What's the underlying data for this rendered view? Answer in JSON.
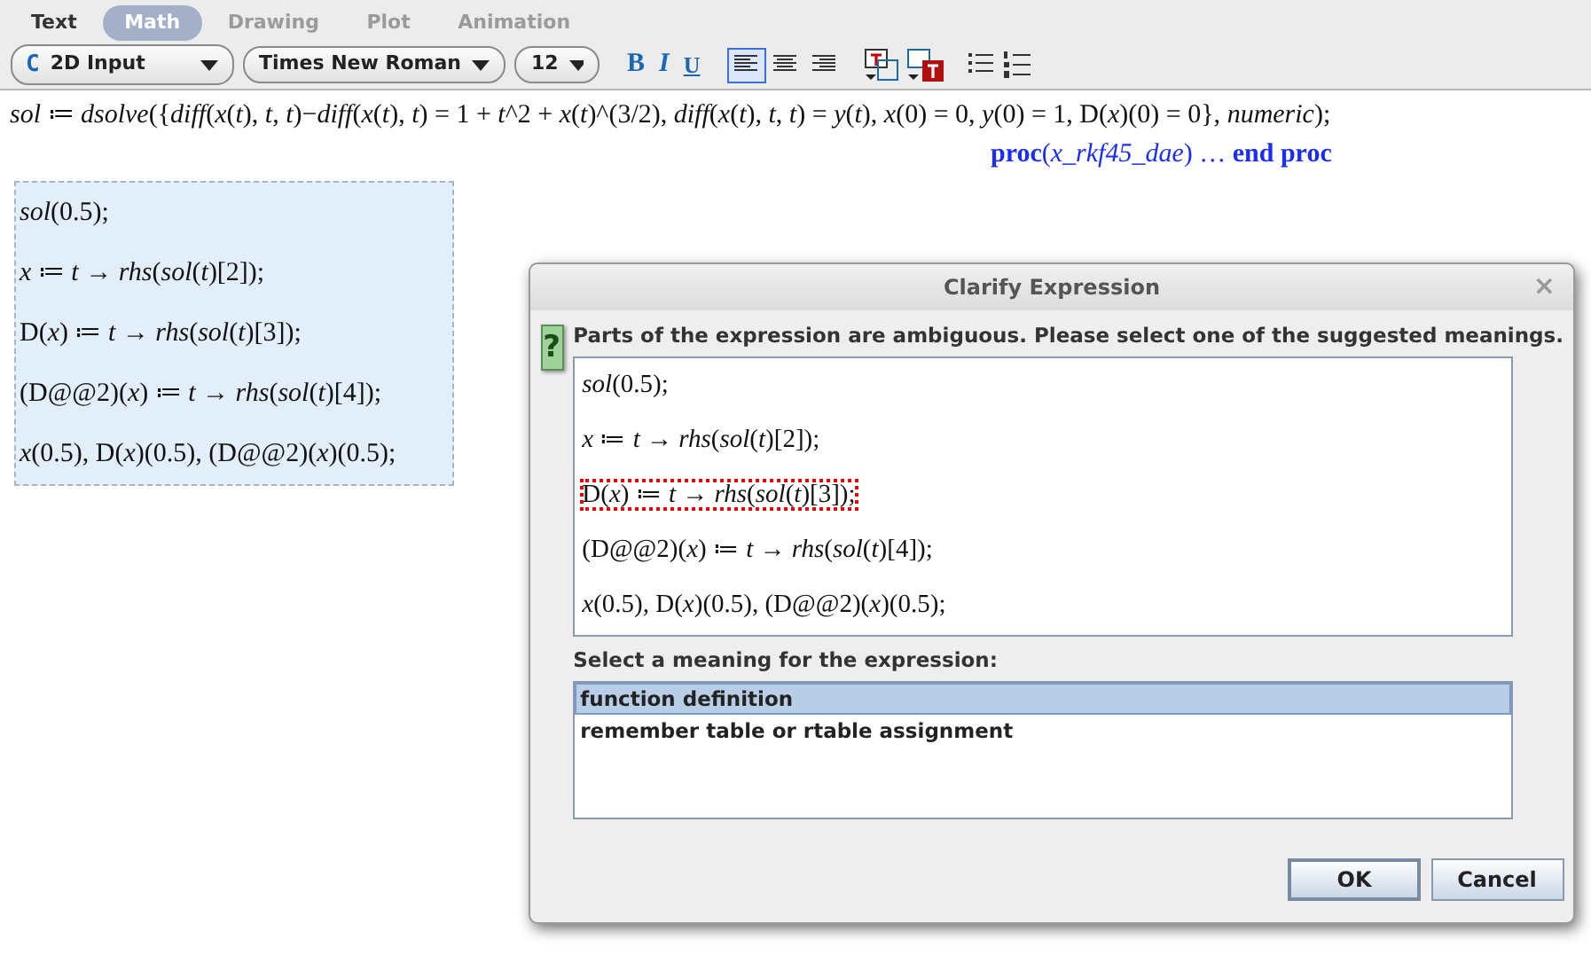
{
  "mode_tabs": [
    {
      "label": "Text",
      "selected": false
    },
    {
      "label": "Math",
      "selected": true
    },
    {
      "label": "Drawing",
      "selected": false
    },
    {
      "label": "Plot",
      "selected": false
    },
    {
      "label": "Animation",
      "selected": false
    }
  ],
  "toolbar": {
    "input_mode": {
      "icon": "C",
      "label": "2D Input"
    },
    "font": "Times New Roman",
    "size": "12",
    "styles": [
      {
        "label": "B",
        "kind": "bold",
        "on": false
      },
      {
        "label": "I",
        "kind": "italic",
        "on": false
      },
      {
        "label": "U",
        "kind": "underline",
        "on": false
      }
    ],
    "alignment": [
      {
        "kind": "left",
        "selected": true
      },
      {
        "kind": "center",
        "selected": false
      },
      {
        "kind": "right",
        "selected": false
      }
    ]
  },
  "document": {
    "input": "*sol* ≔ *dsolve*({*diff*(*x*(*t*), *t*, *t*)−*diff*(*x*(*t*), *t*) = 1 + *t*^2 + *x*(*t*)^(3/2), *diff*(*x*(*t*), *t*, *t*) = *y*(*t*), *x*(0) = 0, *y*(0) = 1, D(*x*)(0) = 0}, *numeric*);",
    "output": "**proc**(*x_rkf45_dae*)  …  **end proc**",
    "selected_block": [
      "*sol*(0.5);",
      "*x* ≔ *t* → *rhs*(*sol*(*t*)[2]);",
      "D(*x*) ≔ *t* → *rhs*(*sol*(*t*)[3]);",
      "(D@@2)(*x*) ≔ *t* → *rhs*(*sol*(*t*)[4]);",
      "*x*(0.5),  D(*x*)(0.5),  (D@@2)(*x*)(0.5);"
    ]
  },
  "dialog": {
    "title": "Clarify Expression",
    "close": "×",
    "icon": "?",
    "message": "Parts of the expression are ambiguous. Please select one of the suggested meanings.",
    "expressions": [
      {
        "text": "*sol*(0.5);",
        "selected": false
      },
      {
        "text": "*x* ≔ *t* → *rhs*(*sol*(*t*)[2]);",
        "selected": false
      },
      {
        "text": "D(*x*) ≔ *t* → *rhs*(*sol*(*t*)[3]);",
        "selected": true
      },
      {
        "text": "(D@@2)(*x*) ≔ *t* → *rhs*(*sol*(*t*)[4]);",
        "selected": false
      },
      {
        "text": "*x*(0.5), D(*x*)(0.5), (D@@2)(*x*)(0.5);",
        "selected": false
      }
    ],
    "meaning_label": "Select a meaning for the expression:",
    "meanings": [
      {
        "label": "function definition",
        "selected": true
      },
      {
        "label": "remember table or rtable assignment",
        "selected": false
      }
    ],
    "buttons": [
      {
        "label": "OK",
        "kind": "default"
      },
      {
        "label": "Cancel",
        "kind": "normal"
      }
    ]
  }
}
